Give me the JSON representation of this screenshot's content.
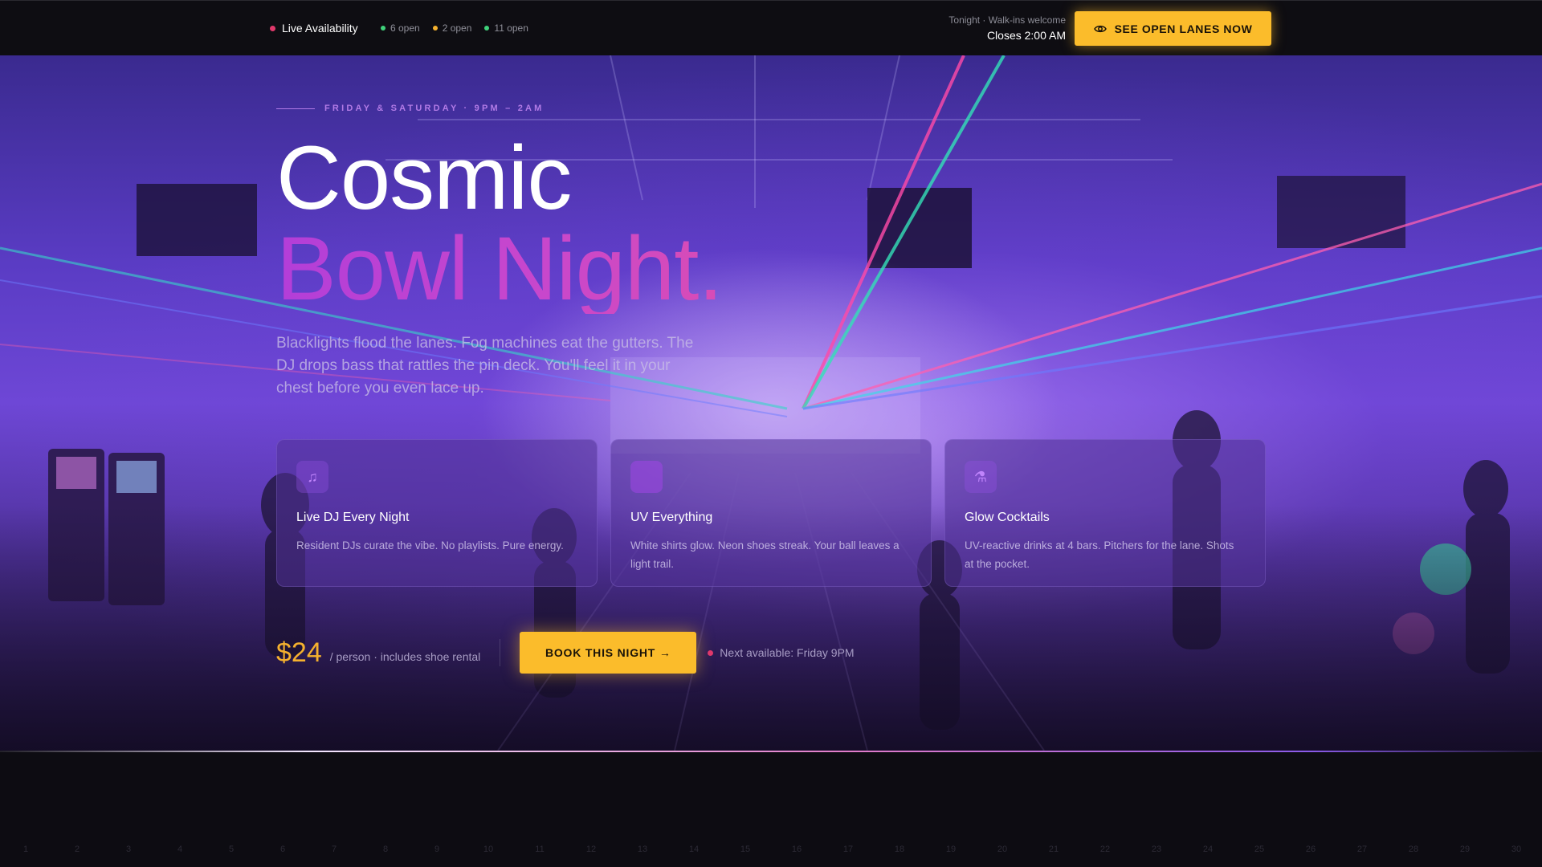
{
  "topbar": {
    "live_label": "Live Availability",
    "live_color": "#e0386b",
    "lane_stats": [
      {
        "label": "6 open",
        "color": "#3fd17a"
      },
      {
        "label": "2 open",
        "color": "#f5b12e"
      },
      {
        "label": "11 open",
        "color": "#3fd17a"
      }
    ],
    "tonight_label": "Tonight · Walk-ins welcome",
    "closes_label": "Closes 2:00 AM",
    "cta_label": "SEE OPEN LANES NOW",
    "cta_icon": "eye-icon"
  },
  "hero": {
    "eyebrow": "FRIDAY & SATURDAY · 9PM – 2AM",
    "title_line1": "Cosmic",
    "title_line2": "Bowl Night.",
    "description": "Blacklights flood the lanes. Fog machines eat the gutters. The DJ drops bass that rattles the pin deck. You'll feel it in your chest before you even lace up."
  },
  "features": [
    {
      "icon": "music-note-icon",
      "glyph": "♫",
      "title": "Live DJ Every Night",
      "body": "Resident DJs curate the vibe. No playlists. Pure energy."
    },
    {
      "icon": "uv-glow-icon",
      "glyph": "",
      "title": "UV Everything",
      "body": "White shirts glow. Neon shoes streak. Your ball leaves a light trail."
    },
    {
      "icon": "flask-icon",
      "glyph": "⚗",
      "title": "Glow Cocktails",
      "body": "UV-reactive drinks at 4 bars. Pitchers for the lane. Shots at the pocket."
    }
  ],
  "pricing": {
    "price": "$24",
    "note": "/ person · includes shoe rental",
    "book_label": "BOOK THIS NIGHT →",
    "next_available": "Next available: Friday 9PM",
    "next_color": "#e0386b"
  },
  "colors": {
    "accent": "#fbbc2b",
    "purple": "#b33ed8"
  },
  "lanes": [
    "1",
    "2",
    "3",
    "4",
    "5",
    "6",
    "7",
    "8",
    "9",
    "10",
    "11",
    "12",
    "13",
    "14",
    "15",
    "16",
    "17",
    "18",
    "19",
    "20",
    "21",
    "22",
    "23",
    "24",
    "25",
    "26",
    "27",
    "28",
    "29",
    "30"
  ]
}
